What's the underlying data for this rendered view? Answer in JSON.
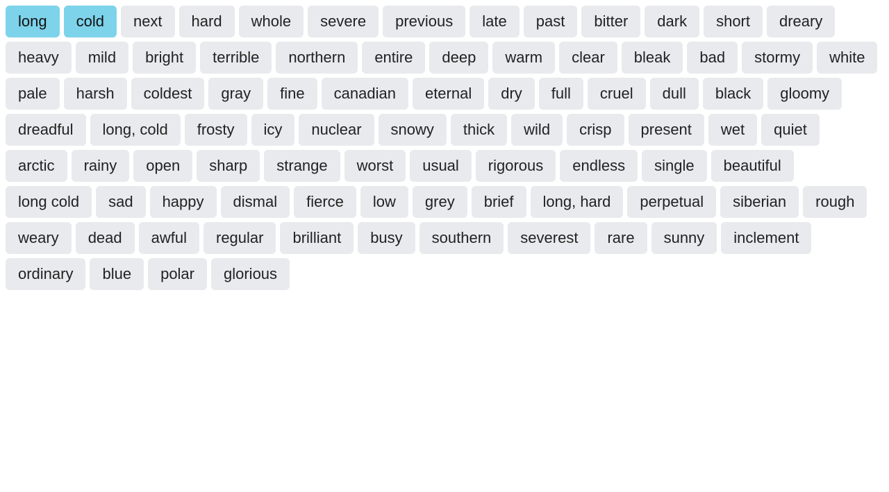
{
  "tags": [
    {
      "label": "long",
      "active": true
    },
    {
      "label": "cold",
      "active": true
    },
    {
      "label": "next",
      "active": false
    },
    {
      "label": "hard",
      "active": false
    },
    {
      "label": "whole",
      "active": false
    },
    {
      "label": "severe",
      "active": false
    },
    {
      "label": "previous",
      "active": false
    },
    {
      "label": "late",
      "active": false
    },
    {
      "label": "past",
      "active": false
    },
    {
      "label": "bitter",
      "active": false
    },
    {
      "label": "dark",
      "active": false
    },
    {
      "label": "short",
      "active": false
    },
    {
      "label": "dreary",
      "active": false
    },
    {
      "label": "heavy",
      "active": false
    },
    {
      "label": "mild",
      "active": false
    },
    {
      "label": "bright",
      "active": false
    },
    {
      "label": "terrible",
      "active": false
    },
    {
      "label": "northern",
      "active": false
    },
    {
      "label": "entire",
      "active": false
    },
    {
      "label": "deep",
      "active": false
    },
    {
      "label": "warm",
      "active": false
    },
    {
      "label": "clear",
      "active": false
    },
    {
      "label": "bleak",
      "active": false
    },
    {
      "label": "bad",
      "active": false
    },
    {
      "label": "stormy",
      "active": false
    },
    {
      "label": "white",
      "active": false
    },
    {
      "label": "pale",
      "active": false
    },
    {
      "label": "harsh",
      "active": false
    },
    {
      "label": "coldest",
      "active": false
    },
    {
      "label": "gray",
      "active": false
    },
    {
      "label": "fine",
      "active": false
    },
    {
      "label": "canadian",
      "active": false
    },
    {
      "label": "eternal",
      "active": false
    },
    {
      "label": "dry",
      "active": false
    },
    {
      "label": "full",
      "active": false
    },
    {
      "label": "cruel",
      "active": false
    },
    {
      "label": "dull",
      "active": false
    },
    {
      "label": "black",
      "active": false
    },
    {
      "label": "gloomy",
      "active": false
    },
    {
      "label": "dreadful",
      "active": false
    },
    {
      "label": "long, cold",
      "active": false
    },
    {
      "label": "frosty",
      "active": false
    },
    {
      "label": "icy",
      "active": false
    },
    {
      "label": "nuclear",
      "active": false
    },
    {
      "label": "snowy",
      "active": false
    },
    {
      "label": "thick",
      "active": false
    },
    {
      "label": "wild",
      "active": false
    },
    {
      "label": "crisp",
      "active": false
    },
    {
      "label": "present",
      "active": false
    },
    {
      "label": "wet",
      "active": false
    },
    {
      "label": "quiet",
      "active": false
    },
    {
      "label": "arctic",
      "active": false
    },
    {
      "label": "rainy",
      "active": false
    },
    {
      "label": "open",
      "active": false
    },
    {
      "label": "sharp",
      "active": false
    },
    {
      "label": "strange",
      "active": false
    },
    {
      "label": "worst",
      "active": false
    },
    {
      "label": "usual",
      "active": false
    },
    {
      "label": "rigorous",
      "active": false
    },
    {
      "label": "endless",
      "active": false
    },
    {
      "label": "single",
      "active": false
    },
    {
      "label": "beautiful",
      "active": false
    },
    {
      "label": "long cold",
      "active": false
    },
    {
      "label": "sad",
      "active": false
    },
    {
      "label": "happy",
      "active": false
    },
    {
      "label": "dismal",
      "active": false
    },
    {
      "label": "fierce",
      "active": false
    },
    {
      "label": "low",
      "active": false
    },
    {
      "label": "grey",
      "active": false
    },
    {
      "label": "brief",
      "active": false
    },
    {
      "label": "long, hard",
      "active": false
    },
    {
      "label": "perpetual",
      "active": false
    },
    {
      "label": "siberian",
      "active": false
    },
    {
      "label": "rough",
      "active": false
    },
    {
      "label": "weary",
      "active": false
    },
    {
      "label": "dead",
      "active": false
    },
    {
      "label": "awful",
      "active": false
    },
    {
      "label": "regular",
      "active": false
    },
    {
      "label": "brilliant",
      "active": false
    },
    {
      "label": "busy",
      "active": false
    },
    {
      "label": "southern",
      "active": false
    },
    {
      "label": "severest",
      "active": false
    },
    {
      "label": "rare",
      "active": false
    },
    {
      "label": "sunny",
      "active": false
    },
    {
      "label": "inclement",
      "active": false
    },
    {
      "label": "ordinary",
      "active": false
    },
    {
      "label": "blue",
      "active": false
    },
    {
      "label": "polar",
      "active": false
    },
    {
      "label": "glorious",
      "active": false
    }
  ]
}
